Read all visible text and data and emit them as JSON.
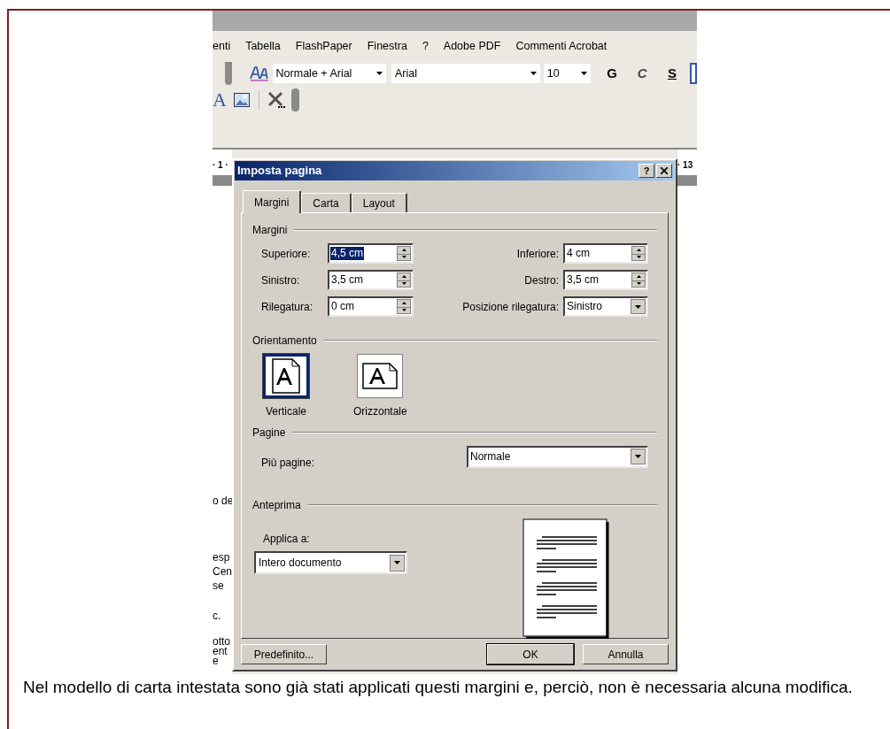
{
  "menu_bar": [
    {
      "label": "enti"
    },
    {
      "label": "Tabella"
    },
    {
      "label": "FlashPaper"
    },
    {
      "label": "Finestra"
    },
    {
      "label": "?"
    },
    {
      "label": "Adobe PDF"
    },
    {
      "label": "Commenti Acrobat"
    }
  ],
  "toolbar": {
    "style": "Normale + Arial",
    "font": "Arial",
    "size": "10",
    "format_buttons": [
      "G",
      "C",
      "S"
    ]
  },
  "toolbar2": {
    "letter": "A"
  },
  "ruler": {
    "left": "· 1 ·",
    "right": "· 13"
  },
  "document_fragments": [
    [
      "o de"
    ],
    [
      "esp",
      "Cen",
      "se"
    ],
    [
      "c."
    ],
    [
      "otto",
      "ent",
      "e"
    ]
  ],
  "dialog": {
    "title": "Imposta pagina",
    "help": "?",
    "tabs": [
      {
        "label": "Margini",
        "selected": true
      },
      {
        "label": "Carta",
        "selected": false
      },
      {
        "label": "Layout",
        "selected": false
      }
    ],
    "margins_heading": "Margini",
    "margin_rows": [
      {
        "left": {
          "kind": "spin",
          "label": "Superiore:",
          "value": "4,5 cm",
          "highlighted": true
        },
        "right": {
          "kind": "spin",
          "label": "Inferiore:",
          "value": "4 cm",
          "highlighted": false
        }
      },
      {
        "left": {
          "kind": "spin",
          "label": "Sinistro:",
          "value": "3,5 cm",
          "highlighted": false
        },
        "right": {
          "kind": "spin",
          "label": "Destro:",
          "value": "3,5 cm",
          "highlighted": false
        }
      },
      {
        "left": {
          "kind": "spin",
          "label": "Rilegatura:",
          "value": "0 cm",
          "highlighted": false
        },
        "right": {
          "kind": "dropdown",
          "label": "Posizione rilegatura:",
          "value": "Sinistro",
          "highlighted": false
        }
      }
    ],
    "orientation_heading": "Orientamento",
    "orientations": [
      {
        "label": "Verticale",
        "kind": "portrait",
        "selected": true
      },
      {
        "label": "Orizzontale",
        "kind": "landscape",
        "selected": false
      }
    ],
    "pages_heading": "Pagine",
    "multiple_pages": {
      "label": "Più pagine:",
      "value": "Normale"
    },
    "preview_heading": "Anteprima",
    "apply_to": {
      "label": "Applica a:",
      "value": "Intero documento"
    },
    "buttons": [
      {
        "label": "Predefinito...",
        "kind": "left"
      },
      {
        "label": "OK",
        "kind": "default"
      },
      {
        "label": "Annulla",
        "kind": "normal"
      }
    ]
  },
  "caption": "Nel modello di carta intestata sono già stati applicati questi margini e, perciò, non è necessaria alcuna modifica."
}
